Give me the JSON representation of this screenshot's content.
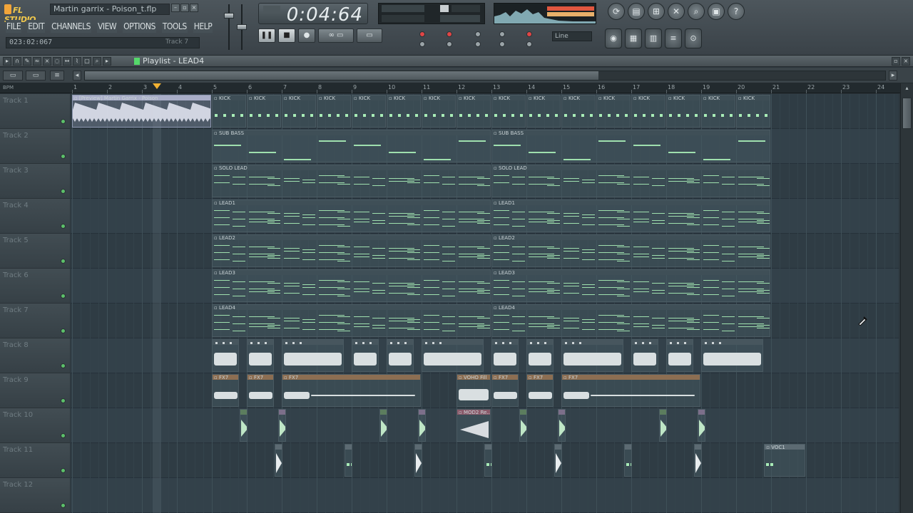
{
  "app": {
    "logo": "FL STUDIO",
    "title": "Martin garrix - Poison_t.flp",
    "hint": "023:02:067",
    "hint_right": "Track 7",
    "time": "0:04:64",
    "menu": [
      "FILE",
      "EDIT",
      "CHANNELS",
      "VIEW",
      "OPTIONS",
      "TOOLS",
      "HELP"
    ],
    "line_select": "Line"
  },
  "playlist": {
    "title": "Playlist - LEAD4",
    "ruler_label": "BPM",
    "bars": [
      "1",
      "2",
      "3",
      "4",
      "5",
      "6",
      "7",
      "8",
      "9",
      "10",
      "11",
      "12",
      "13",
      "14",
      "15",
      "16",
      "17",
      "18",
      "19",
      "20",
      "21",
      "22",
      "23",
      "24"
    ],
    "tracks": [
      "Track 1",
      "Track 2",
      "Track 3",
      "Track 4",
      "Track 5",
      "Track 6",
      "Track 7",
      "Track 8",
      "Track 9",
      "Track 10",
      "Track 11",
      "Track 12"
    ],
    "clips": {
      "preview": "[Preview] Martin Garrix - Poison",
      "kick": "KICK",
      "sub_bass": "SUB BASS",
      "solo_lead": "SOLO LEAD",
      "lead1": "LEAD1",
      "lead2": "LEAD2",
      "lead3": "LEAD3",
      "lead4": "LEAD4",
      "fx7": "FX7",
      "vocal": "VOHO Fill",
      "mod": "MOD2 Re...",
      "vox": "VOC1"
    }
  },
  "colors": {
    "accent_green": "#55d96b",
    "note_green": "#9fe0ae",
    "marker": "#f2b233"
  }
}
